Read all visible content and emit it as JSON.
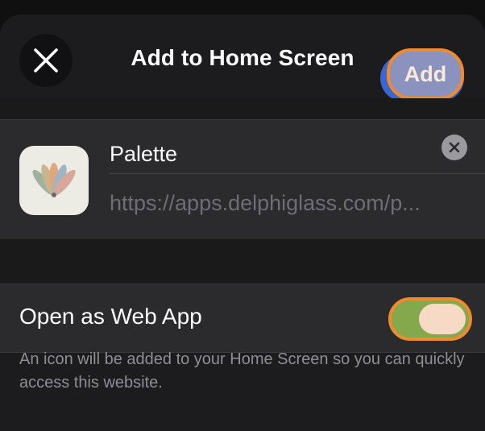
{
  "sheet": {
    "title": "Add to Home Screen",
    "close_icon": "close-icon",
    "add_label": "Add"
  },
  "app": {
    "icon": "palette-fan-icon",
    "name_value": "Palette",
    "url_value": "https://apps.delphiglass.com/p...",
    "clear_icon": "clear-icon"
  },
  "web_app": {
    "label": "Open as Web App",
    "enabled": true
  },
  "footnote": "An icon will be added to your Home Screen so you can quickly access this website.",
  "colors": {
    "accent_highlight": "#ef8a2e",
    "toggle_on": "#84a94c",
    "add_button": "#8c92be"
  }
}
